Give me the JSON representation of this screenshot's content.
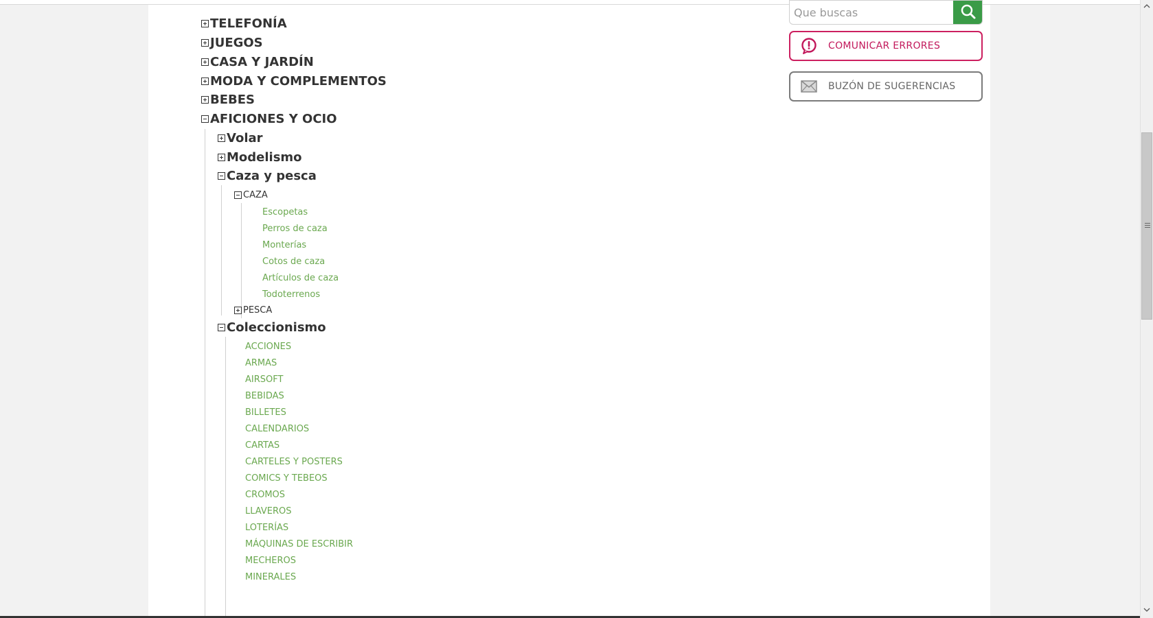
{
  "search": {
    "placeholder": "Que buscas"
  },
  "buttons": {
    "report_errors": "COMUNICAR ERRORES",
    "suggestions": "BUZÓN DE SUGERENCIAS"
  },
  "tree": {
    "top": [
      "TELEFONÍA",
      "JUEGOS",
      "CASA Y JARDÍN",
      "MODA Y COMPLEMENTOS",
      "BEBES",
      "AFICIONES Y OCIO"
    ],
    "aficiones": [
      "Volar",
      "Modelismo",
      "Caza y pesca",
      "Coleccionismo"
    ],
    "caza_y_pesca": [
      "CAZA",
      "PESCA"
    ],
    "caza_items": [
      "Escopetas",
      "Perros de caza",
      "Monterías",
      "Cotos de caza",
      "Artículos de caza",
      "Todoterrenos"
    ],
    "coleccionismo_items": [
      "ACCIONES",
      "ARMAS",
      "AIRSOFT",
      "BEBIDAS",
      "BILLETES",
      "CALENDARIOS",
      "CARTAS",
      "CARTELES Y POSTERS",
      "COMICS Y TEBEOS",
      "CROMOS",
      "LLAVEROS",
      "LOTERÍAS",
      "MÁQUINAS DE ESCRIBIR",
      "MECHEROS",
      "MINERALES"
    ]
  },
  "colors": {
    "accent_green": "#3a9b47",
    "error_pink": "#c2185b",
    "link_green": "#6aa84f"
  },
  "icons": {
    "search": "magnifier-icon",
    "error": "alert-bubble-icon",
    "mail": "envelope-icon"
  }
}
